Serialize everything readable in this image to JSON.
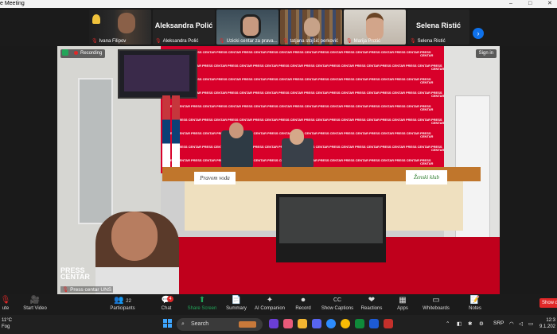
{
  "window": {
    "title": "e Meeting",
    "controls": [
      "–",
      "□",
      "✕"
    ]
  },
  "gallery": {
    "tiles": [
      {
        "name": "Ivana Filipov",
        "video": true
      },
      {
        "name": "Aleksandra Polić",
        "display_name": "Aleksandra Polić",
        "video": false
      },
      {
        "name": "Uzicki centar za prava...",
        "video": true
      },
      {
        "name": "tatjana stojšić perković",
        "video": true
      },
      {
        "name": "Marija Protić",
        "video": true
      },
      {
        "name": "Selena Ristić",
        "display_name": "Selena Ristić",
        "video": false
      }
    ],
    "next_icon": "›"
  },
  "main_video": {
    "recording_label": "Recording",
    "sign_in_label": "Sign in",
    "speaker_name": "Press centar UNS",
    "logo_line1": "PRESS",
    "logo_line2": "CENTAR",
    "plaque_left": "Pravom voda",
    "plaque_right": "Ženski klub",
    "backdrop_tile_text": "PRESS CENTAR"
  },
  "toolbar": {
    "items": [
      {
        "id": "mute",
        "icon": "mic-off-icon",
        "glyph": "🎙",
        "label": "ute"
      },
      {
        "id": "video",
        "icon": "video-off-icon",
        "glyph": "🎥",
        "label": "Start Video"
      },
      {
        "id": "participants",
        "icon": "participants-icon",
        "glyph": "👥",
        "label": "Participants",
        "count": "22"
      },
      {
        "id": "chat",
        "icon": "chat-icon",
        "glyph": "💬",
        "label": "Chat",
        "badge": "4"
      },
      {
        "id": "share",
        "icon": "share-screen-icon",
        "glyph": "⬆",
        "label": "Share Screen"
      },
      {
        "id": "summary",
        "icon": "summary-icon",
        "glyph": "📄",
        "label": "Summary"
      },
      {
        "id": "ai",
        "icon": "ai-companion-icon",
        "glyph": "✦",
        "label": "AI Companion"
      },
      {
        "id": "record",
        "icon": "record-icon",
        "glyph": "⏺",
        "label": "Record"
      },
      {
        "id": "captions",
        "icon": "captions-icon",
        "glyph": "CC",
        "label": "Show Captions"
      },
      {
        "id": "reactions",
        "icon": "reactions-icon",
        "glyph": "❤",
        "label": "Reactions"
      },
      {
        "id": "apps",
        "icon": "apps-icon",
        "glyph": "▦",
        "label": "Apps"
      },
      {
        "id": "whiteboards",
        "icon": "whiteboards-icon",
        "glyph": "▭",
        "label": "Whiteboards"
      },
      {
        "id": "notes",
        "icon": "notes-icon",
        "glyph": "📝",
        "label": "Notes"
      }
    ],
    "show_label": "Show d"
  },
  "taskbar": {
    "weather_temp": "11°C",
    "weather_desc": "Fog",
    "search_placeholder": "Search",
    "language": "SRP",
    "time": "12:3",
    "date": "9.1.202"
  }
}
